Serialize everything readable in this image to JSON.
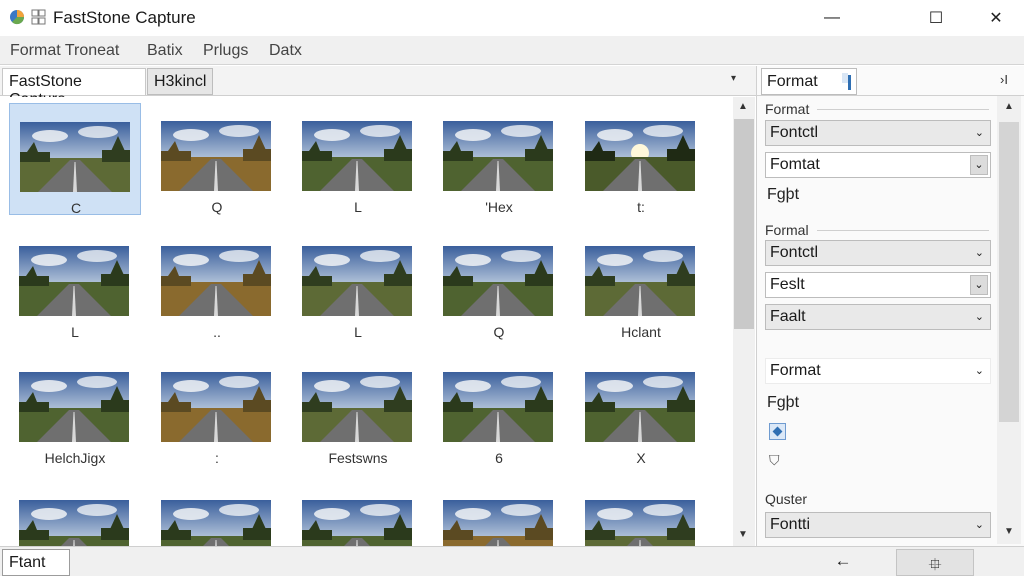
{
  "window": {
    "title": "FastStone Capture",
    "controls": {
      "minimize": "—",
      "maximize": "☐",
      "close": "✕"
    }
  },
  "menu": [
    "Format Troneat",
    "Batix",
    "Prlugs",
    "Datx"
  ],
  "tabs": {
    "items": [
      "FastStone Capture",
      "H3kincl"
    ],
    "dropdown_glyph": "▾"
  },
  "grid": {
    "cells": [
      {
        "caption": "C",
        "selected": true,
        "scene": "dusk"
      },
      {
        "caption": "Q",
        "scene": "golden"
      },
      {
        "caption": "L",
        "scene": "clouds"
      },
      {
        "caption": "'Hex",
        "scene": "clouds"
      },
      {
        "caption": "t:",
        "scene": "sunburst"
      },
      {
        "caption": "L",
        "scene": "clouds"
      },
      {
        "caption": "..",
        "scene": "golden"
      },
      {
        "caption": "L",
        "scene": "dusk"
      },
      {
        "caption": "Q",
        "scene": "clouds"
      },
      {
        "caption": "Hclant",
        "scene": "dusk"
      },
      {
        "caption": "HelchJigx",
        "scene": "clouds"
      },
      {
        "caption": ":",
        "scene": "golden"
      },
      {
        "caption": "Festswns",
        "scene": "dusk"
      },
      {
        "caption": "6",
        "scene": "clouds"
      },
      {
        "caption": "X",
        "scene": "clouds"
      },
      {
        "caption": "",
        "scene": "clouds"
      },
      {
        "caption": "",
        "scene": "clouds"
      },
      {
        "caption": "",
        "scene": "clouds"
      },
      {
        "caption": "",
        "scene": "golden"
      },
      {
        "caption": "",
        "scene": "dusk"
      }
    ]
  },
  "scrollbar": {
    "up": "▲",
    "down": "▼"
  },
  "panel": {
    "tab_label": "Format",
    "collapse_glyph": "›I",
    "section1_label": "Format",
    "select1": "Fontctl",
    "select2": "Fomtat",
    "item1": "Fgþt",
    "section2_label": "Formal",
    "select3": "Fontctl",
    "select4": "Feslt",
    "select5": "Faalt",
    "select6": "Format",
    "item2": "Fgþt",
    "section3_label": "Quster",
    "select7": "Fontti",
    "chevron": "⌄",
    "scroll_up": "▲",
    "scroll_down": "▼"
  },
  "status": {
    "text": "Ftant ...",
    "back_glyph": "←",
    "action_glyph": "⯐"
  }
}
